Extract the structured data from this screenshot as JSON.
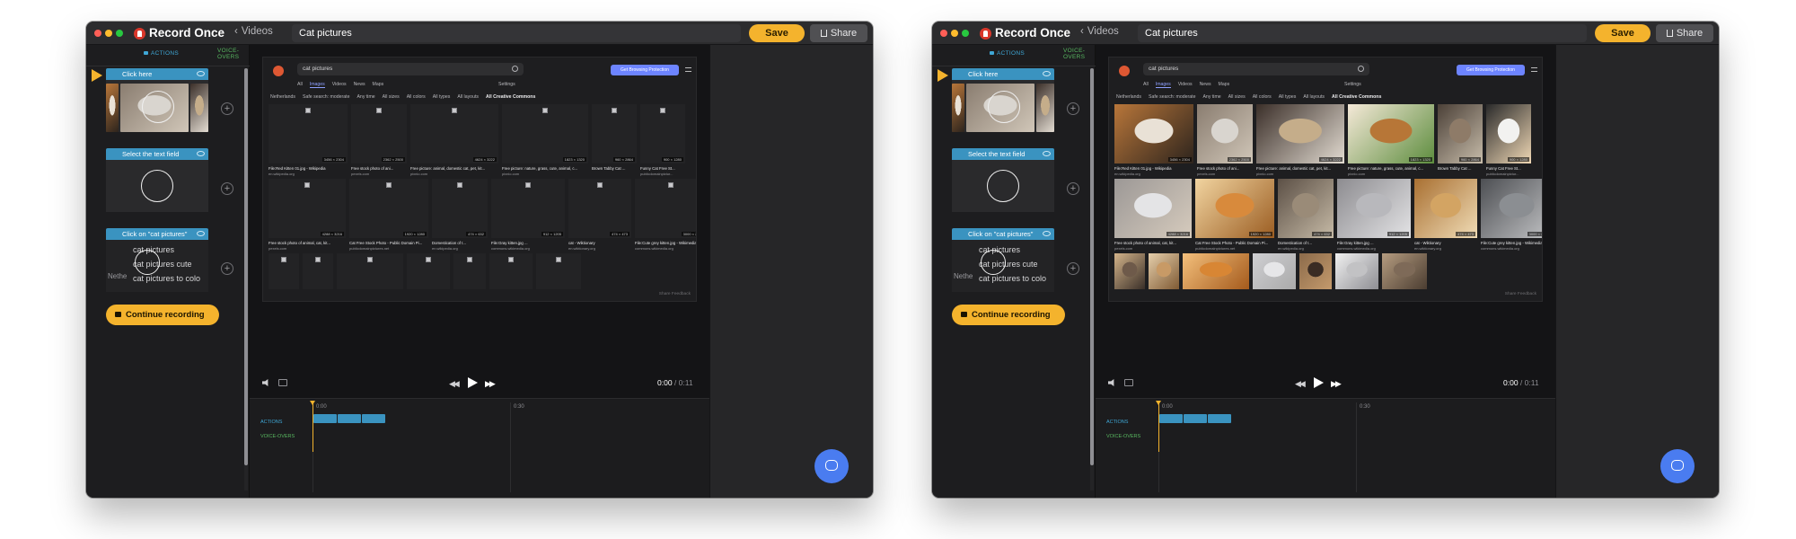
{
  "windows": [
    {
      "titlebar": {
        "app_name": "Record Once",
        "back_label": "Videos",
        "title_value": "Cat pictures",
        "save_label": "Save",
        "share_label": "Share"
      },
      "left_panel": {
        "tab_actions": "ACTIONS",
        "tab_voice": "VOICE-OVERS",
        "steps": [
          {
            "label": "Click here"
          },
          {
            "label": "Select the text field"
          },
          {
            "label": "Click on \"cat pictures\""
          }
        ],
        "suggestions": [
          "cat pictures",
          "cat pictures cute",
          "cat pictures to colo"
        ],
        "suggestion_bold": [
          "",
          "cute",
          "to colo"
        ],
        "netherlands_text": "Nethe",
        "continue_label": "Continue recording"
      },
      "browser": {
        "search_value": "cat pictures",
        "protection_label": "Get Browsing Protection",
        "tabs": [
          "All",
          "Images",
          "Videos",
          "News",
          "Maps"
        ],
        "active_tab": "Images",
        "settings_label": "Settings",
        "filters": [
          "Netherlands",
          "Safe search: moderate",
          "Any time",
          "All sizes",
          "All colors",
          "All types",
          "All layouts",
          "All Creative Commons"
        ],
        "feedback_label": "Share Feedback",
        "images_loaded": false,
        "rows": [
          [
            {
              "caption": "File:Red Kitten 01.jpg - Wikipedia",
              "source": "en.wikipedia.org",
              "dims": "3456 × 2304"
            },
            {
              "caption": "Free stock photo of ani...",
              "source": "pexels.com",
              "dims": "2362 × 2500"
            },
            {
              "caption": "Free picture: animal, domestic cat, pet, kit...",
              "source": "pixnio.com",
              "dims": "4624 × 3222"
            },
            {
              "caption": "Free picture: nature, grass, cute, animal, c...",
              "source": "pixnio.com",
              "dims": "1823 × 1320"
            },
            {
              "caption": "Brown Tabby Cat ...",
              "source": "",
              "dims": "960 × 2864"
            },
            {
              "caption": "Funny Cat Free St...",
              "source": "publicdomainpictur...",
              "dims": "900 × 1280"
            }
          ],
          [
            {
              "caption": "Free stock photo of animal, cat, kit...",
              "source": "pexels.com",
              "dims": "4288 × 3216"
            },
            {
              "caption": "Cat Free Stock Photo - Public Domain Pi...",
              "source": "publicdomainpictures.net",
              "dims": "1920 × 1280"
            },
            {
              "caption": "Domestication of t...",
              "source": "en.wikipedia.org",
              "dims": "474 × 632"
            },
            {
              "caption": "File:Gray kitten.jpg ...",
              "source": "commons.wikimedia.org",
              "dims": "912 × 1205"
            },
            {
              "caption": "cat - Wiktionary",
              "source": "en.wiktionary.org",
              "dims": "474 × 473"
            },
            {
              "caption": "File:Cute grey kitten.jpg - Wikimedia Co...",
              "source": "commons.wikimedia.org",
              "dims": "3000 × 2000"
            }
          ]
        ]
      },
      "player": {
        "current_time": "0:00",
        "total_time": " / 0:11"
      },
      "timeline": {
        "tick_0": "0:00",
        "tick_30": "0:30",
        "label_actions": "ACTIONS",
        "label_voice": "VOICE-OVERS"
      }
    },
    {
      "titlebar": {
        "app_name": "Record Once",
        "back_label": "Videos",
        "title_value": "Cat pictures",
        "save_label": "Save",
        "share_label": "Share"
      },
      "left_panel": {
        "tab_actions": "ACTIONS",
        "tab_voice": "VOICE-OVERS",
        "steps": [
          {
            "label": "Click here"
          },
          {
            "label": "Select the text field"
          },
          {
            "label": "Click on \"cat pictures\""
          }
        ],
        "suggestions": [
          "cat pictures",
          "cat pictures cute",
          "cat pictures to colo"
        ],
        "suggestion_bold": [
          "",
          "cute",
          "to colo"
        ],
        "netherlands_text": "Nethe",
        "continue_label": "Continue recording"
      },
      "browser": {
        "search_value": "cat pictures",
        "protection_label": "Get Browsing Protection",
        "tabs": [
          "All",
          "Images",
          "Videos",
          "News",
          "Maps"
        ],
        "active_tab": "Images",
        "settings_label": "Settings",
        "filters": [
          "Netherlands",
          "Safe search: moderate",
          "Any time",
          "All sizes",
          "All colors",
          "All types",
          "All layouts",
          "All Creative Commons"
        ],
        "feedback_label": "Share Feedback",
        "images_loaded": true,
        "rows": [
          [
            {
              "caption": "File:Red Kitten 01.jpg - Wikipedia",
              "source": "en.wikipedia.org",
              "dims": "3456 × 2304"
            },
            {
              "caption": "Free stock photo of ani...",
              "source": "pexels.com",
              "dims": "2362 × 2500"
            },
            {
              "caption": "Free picture: animal, domestic cat, pet, kit...",
              "source": "pixnio.com",
              "dims": "4624 × 3222"
            },
            {
              "caption": "Free picture: nature, grass, cute, animal, c...",
              "source": "pixnio.com",
              "dims": "1823 × 1320"
            },
            {
              "caption": "Brown Tabby Cat ...",
              "source": "",
              "dims": "960 × 2864"
            },
            {
              "caption": "Funny Cat Free St...",
              "source": "publicdomainpictur...",
              "dims": "900 × 1280"
            }
          ],
          [
            {
              "caption": "Free stock photo of animal, cat, kit...",
              "source": "pexels.com",
              "dims": "4288 × 3216"
            },
            {
              "caption": "Cat Free Stock Photo - Public Domain Pi...",
              "source": "publicdomainpictures.net",
              "dims": "1920 × 1280"
            },
            {
              "caption": "Domestication of t...",
              "source": "en.wikipedia.org",
              "dims": "474 × 632"
            },
            {
              "caption": "File:Gray kitten.jpg ...",
              "source": "commons.wikimedia.org",
              "dims": "912 × 1205"
            },
            {
              "caption": "cat - Wiktionary",
              "source": "en.wiktionary.org",
              "dims": "474 × 473"
            },
            {
              "caption": "File:Cute grey kitten.jpg - Wikimedia Co...",
              "source": "commons.wikimedia.org",
              "dims": "3000 × 2000"
            }
          ]
        ]
      },
      "player": {
        "current_time": "0:00",
        "total_time": " / 0:11"
      },
      "timeline": {
        "tick_0": "0:00",
        "tick_30": "0:30",
        "label_actions": "ACTIONS",
        "label_voice": "VOICE-OVERS"
      }
    }
  ],
  "colors": {
    "accent": "#f4b32d",
    "actions_blue": "#3a93c0",
    "voice_green": "#58b860",
    "chat_blue": "#4a7cf0"
  }
}
